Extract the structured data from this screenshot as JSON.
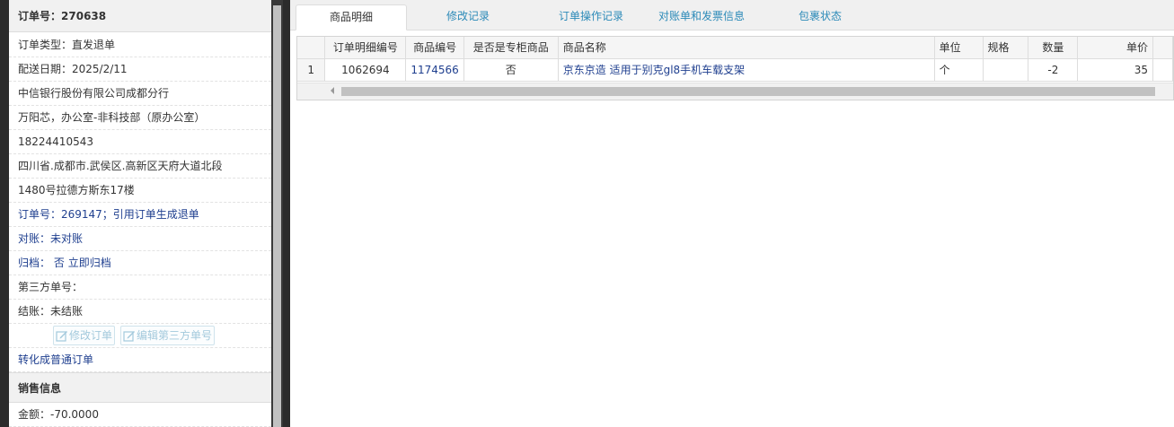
{
  "order": {
    "header_label": "订单号：",
    "header_number": "270638",
    "type": "订单类型：直发退单",
    "delivery_date": "配送日期：2025/2/11",
    "company": "中信银行股份有限公司成都分行",
    "contact": "万阳芯，办公室-非科技部（原办公室）",
    "phone": "18224410543",
    "address_line1": "四川省.成都市.武侯区.高新区天府大道北段",
    "address_line2": "1480号拉德方斯东17楼",
    "ref_order": "订单号：269147；引用订单生成退单",
    "reconcile": "对账：未对账",
    "archive_label": "归档：",
    "archive_value": "否",
    "archive_action": "立即归档",
    "third_party": "第三方单号：",
    "settle": "结账：未结账",
    "edit_order_btn": "修改订单",
    "edit_third_btn": "编辑第三方单号",
    "convert": "转化成普通订单"
  },
  "sales": {
    "section_title": "销售信息",
    "amount": "金额：-70.0000"
  },
  "tabs": [
    {
      "label": "商品明细",
      "active": true
    },
    {
      "label": "修改记录",
      "active": false
    },
    {
      "label": "订单操作记录",
      "active": false
    },
    {
      "label": "对账单和发票信息",
      "active": false
    },
    {
      "label": "包裹状态",
      "active": false
    }
  ],
  "table": {
    "columns": [
      "",
      "订单明细编号",
      "商品编号",
      "是否是专柜商品",
      "商品名称",
      "单位",
      "规格",
      "数量",
      "单价"
    ],
    "rows": [
      [
        "1",
        "1062694",
        "1174566",
        "否",
        "京东京造 适用于别克gl8手机车载支架",
        "个",
        "",
        "-2",
        "35"
      ]
    ]
  },
  "icons": {
    "edit_icon": "pencil-square-icon",
    "scroll_left": "scroll-left-arrow-icon"
  }
}
